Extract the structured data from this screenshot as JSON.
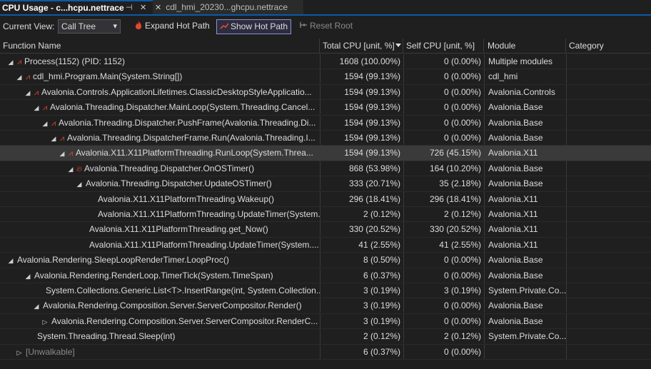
{
  "tabs": [
    {
      "label": "CPU Usage - c...hcpu.nettrace",
      "pin": "⊣",
      "close": "✕"
    },
    {
      "label": "cdl_hmi_20230...ghcpu.nettrace",
      "close": "✕"
    }
  ],
  "toolbar": {
    "current_view_label": "Current View:",
    "view_value": "Call Tree",
    "expand_hot_path": "Expand Hot Path",
    "show_hot_path": "Show Hot Path",
    "reset_root": "Reset Root"
  },
  "columns": {
    "name": "Function Name",
    "total": "Total CPU [unit, %]",
    "self": "Self CPU [unit, %]",
    "module": "Module",
    "category": "Category"
  },
  "rows": [
    {
      "name": "Process(1152) (PID: 1152)",
      "total": "1608 (100.00%)",
      "self": "0 (0.00%)",
      "module": "Multiple modules"
    },
    {
      "name": "cdl_hmi.Program.Main(System.String[])",
      "total": "1594 (99.13%)",
      "self": "0 (0.00%)",
      "module": "cdl_hmi"
    },
    {
      "name": "Avalonia.Controls.ApplicationLifetimes.ClassicDesktopStyleApplicatio...",
      "total": "1594 (99.13%)",
      "self": "0 (0.00%)",
      "module": "Avalonia.Controls"
    },
    {
      "name": "Avalonia.Threading.Dispatcher.MainLoop(System.Threading.Cancel...",
      "total": "1594 (99.13%)",
      "self": "0 (0.00%)",
      "module": "Avalonia.Base"
    },
    {
      "name": "Avalonia.Threading.Dispatcher.PushFrame(Avalonia.Threading.Di...",
      "total": "1594 (99.13%)",
      "self": "0 (0.00%)",
      "module": "Avalonia.Base"
    },
    {
      "name": "Avalonia.Threading.DispatcherFrame.Run(Avalonia.Threading.I...",
      "total": "1594 (99.13%)",
      "self": "0 (0.00%)",
      "module": "Avalonia.Base"
    },
    {
      "name": "Avalonia.X11.X11PlatformThreading.RunLoop(System.Threa...",
      "total": "1594 (99.13%)",
      "self": "726 (45.15%)",
      "module": "Avalonia.X11"
    },
    {
      "name": "Avalonia.Threading.Dispatcher.OnOSTimer()",
      "total": "868 (53.98%)",
      "self": "164 (10.20%)",
      "module": "Avalonia.Base"
    },
    {
      "name": "Avalonia.Threading.Dispatcher.UpdateOSTimer()",
      "total": "333 (20.71%)",
      "self": "35 (2.18%)",
      "module": "Avalonia.Base"
    },
    {
      "name": "Avalonia.X11.X11PlatformThreading.Wakeup()",
      "total": "296 (18.41%)",
      "self": "296 (18.41%)",
      "module": "Avalonia.X11"
    },
    {
      "name": "Avalonia.X11.X11PlatformThreading.UpdateTimer(System...",
      "total": "2 (0.12%)",
      "self": "2 (0.12%)",
      "module": "Avalonia.X11"
    },
    {
      "name": "Avalonia.X11.X11PlatformThreading.get_Now()",
      "total": "330 (20.52%)",
      "self": "330 (20.52%)",
      "module": "Avalonia.X11"
    },
    {
      "name": "Avalonia.X11.X11PlatformThreading.UpdateTimer(System....",
      "total": "41 (2.55%)",
      "self": "41 (2.55%)",
      "module": "Avalonia.X11"
    },
    {
      "name": "Avalonia.Rendering.SleepLoopRenderTimer.LoopProc()",
      "total": "8 (0.50%)",
      "self": "0 (0.00%)",
      "module": "Avalonia.Base"
    },
    {
      "name": "Avalonia.Rendering.RenderLoop.TimerTick(System.TimeSpan)",
      "total": "6 (0.37%)",
      "self": "0 (0.00%)",
      "module": "Avalonia.Base"
    },
    {
      "name": "System.Collections.Generic.List<T>.InsertRange(int, System.Collection...",
      "total": "3 (0.19%)",
      "self": "3 (0.19%)",
      "module": "System.Private.Co..."
    },
    {
      "name": "Avalonia.Rendering.Composition.Server.ServerCompositor.Render()",
      "total": "3 (0.19%)",
      "self": "0 (0.00%)",
      "module": "Avalonia.Base"
    },
    {
      "name": "Avalonia.Rendering.Composition.Server.ServerCompositor.RenderC...",
      "total": "3 (0.19%)",
      "self": "0 (0.00%)",
      "module": "Avalonia.Base"
    },
    {
      "name": "System.Threading.Thread.Sleep(int)",
      "total": "2 (0.12%)",
      "self": "2 (0.12%)",
      "module": "System.Private.Co..."
    },
    {
      "name": "[Unwalkable]",
      "total": "6 (0.37%)",
      "self": "0 (0.00%)",
      "module": ""
    }
  ],
  "colors": {
    "accent": "#0b5aa8",
    "hot": "#e8472f",
    "selection": "#3a3a3a"
  }
}
